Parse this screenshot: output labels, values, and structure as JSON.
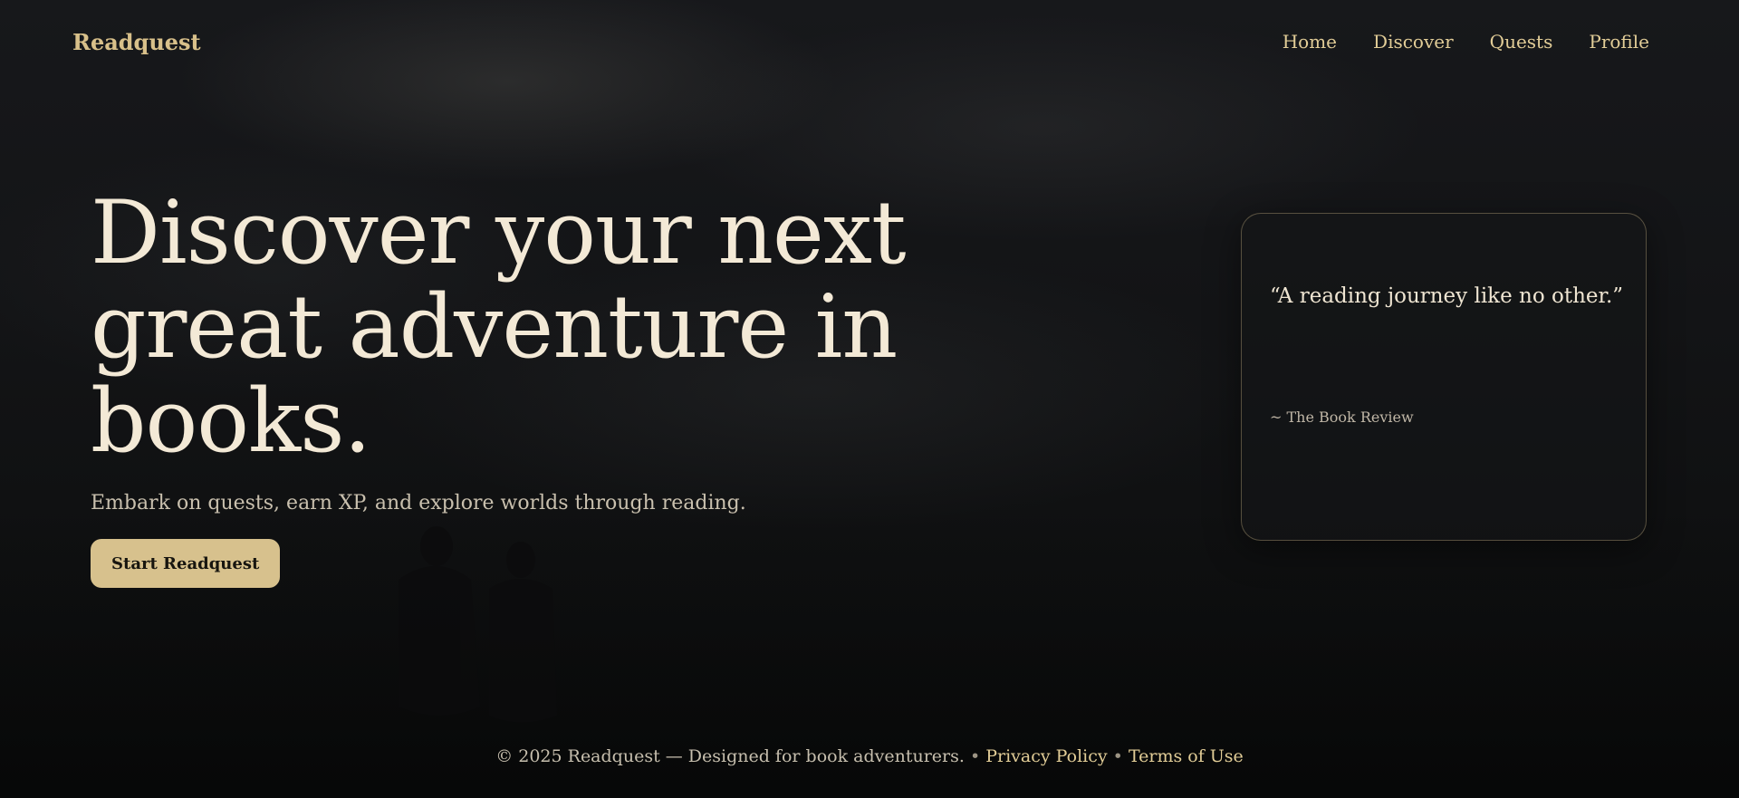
{
  "header": {
    "brand": "Readquest",
    "nav": [
      "Home",
      "Discover",
      "Quests",
      "Profile"
    ]
  },
  "hero": {
    "title": "Discover your next great adventure in books.",
    "subtitle": "Embark on quests, earn XP, and explore worlds through reading.",
    "cta_label": "Start Readquest"
  },
  "quote": {
    "text": "“A reading journey like no other.”",
    "source": "~ The Book Review"
  },
  "footer": {
    "copyright": "© 2025 Readquest — Designed for book adventurers.",
    "separator": "•",
    "privacy": "Privacy Policy",
    "terms": "Terms of Use"
  },
  "colors": {
    "accent": "#d7c18d",
    "text": "#f3e9d6",
    "background": "#131416"
  }
}
